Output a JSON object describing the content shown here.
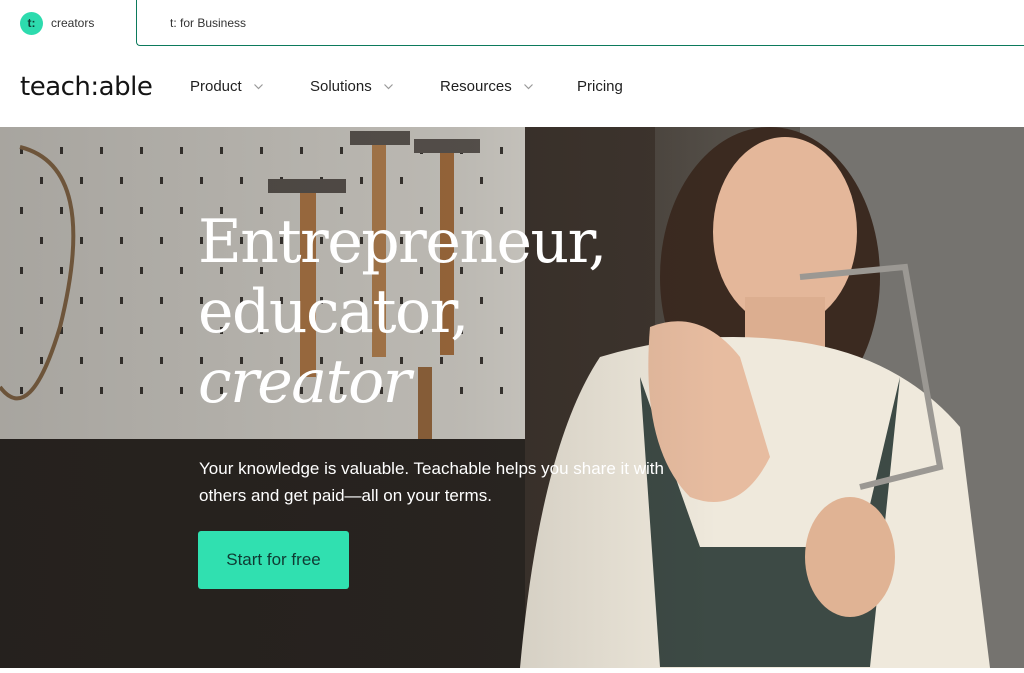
{
  "switcher": {
    "creators_badge": "t:",
    "creators_label": "creators",
    "business_label": "t: for Business"
  },
  "nav": {
    "logo": "teach:able",
    "items": [
      {
        "label": "Product",
        "has_dropdown": true
      },
      {
        "label": "Solutions",
        "has_dropdown": true
      },
      {
        "label": "Resources",
        "has_dropdown": true
      },
      {
        "label": "Pricing",
        "has_dropdown": false
      }
    ]
  },
  "hero": {
    "headline_line1": "Entrepreneur,",
    "headline_line2": "educator,",
    "headline_line3": "creator",
    "subtext": "Your knowledge is valuable. Teachable helps you share it with others and get paid—all on your terms.",
    "cta_label": "Start for free"
  },
  "colors": {
    "accent": "#30e0b0",
    "business_border": "#0c7a5c",
    "cta_text": "#0f3b33"
  },
  "icons": {
    "dropdown": "chevron-down-icon"
  }
}
